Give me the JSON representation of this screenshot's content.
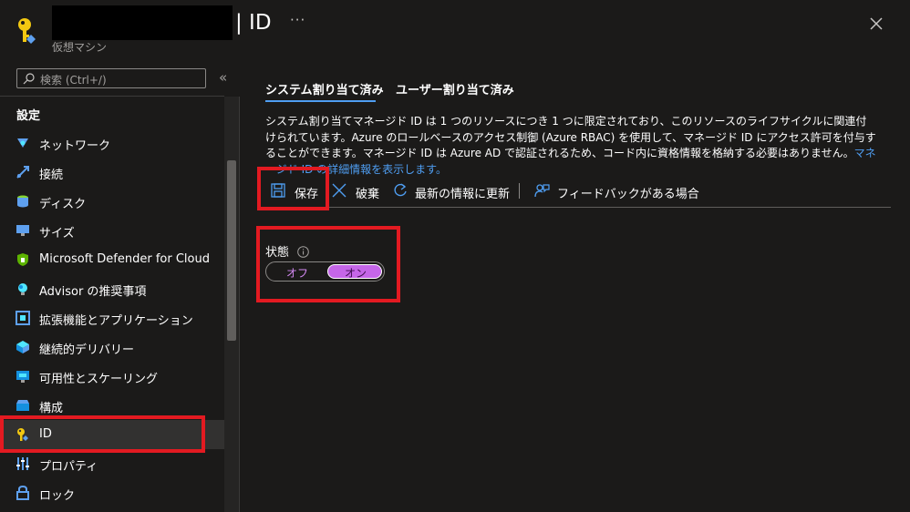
{
  "header": {
    "title": "| ID",
    "subtitle": "仮想マシン",
    "more": "···",
    "resource_icon": "key-icon",
    "close_icon": "close-icon"
  },
  "sidebar": {
    "search_placeholder": "検索 (Ctrl+/)",
    "collapse": "«",
    "section": "設定",
    "items": [
      {
        "label": "ネットワーク",
        "icon": "network-icon"
      },
      {
        "label": "接続",
        "icon": "connect-icon"
      },
      {
        "label": "ディスク",
        "icon": "disk-icon"
      },
      {
        "label": "サイズ",
        "icon": "monitor-icon"
      },
      {
        "label": "Microsoft Defender for Cloud",
        "icon": "shield-icon"
      },
      {
        "label": "Advisor の推奨事項",
        "icon": "advisor-icon"
      },
      {
        "label": "拡張機能とアプリケーション",
        "icon": "extensions-icon"
      },
      {
        "label": "継続的デリバリー",
        "icon": "delivery-icon"
      },
      {
        "label": "可用性とスケーリング",
        "icon": "scaling-icon"
      },
      {
        "label": "構成",
        "icon": "configuration-icon"
      },
      {
        "label": "ID",
        "icon": "key-icon",
        "selected": true
      },
      {
        "label": "プロパティ",
        "icon": "properties-icon"
      },
      {
        "label": "ロック",
        "icon": "lock-icon"
      }
    ]
  },
  "tabs": [
    {
      "label": "システム割り当て済み",
      "active": true
    },
    {
      "label": "ユーザー割り当て済み",
      "active": false
    }
  ],
  "description": {
    "text": "システム割り当てマネージド ID は 1 つのリソースにつき 1 つに限定されており、このリソースのライフサイクルに関連付けられています。Azure のロールベースのアクセス制御 (Azure RBAC) を使用して、マネージド ID にアクセス許可を付与することができます。マネージド ID は Azure AD で認証されるため、コード内に資格情報を格納する必要はありません。",
    "link": "マネージド ID の詳細情報を表示します。"
  },
  "toolbar": {
    "save": "保存",
    "discard": "破棄",
    "refresh": "最新の情報に更新",
    "feedback": "フィードバックがある場合"
  },
  "status": {
    "label": "状態",
    "off": "オフ",
    "on": "オン",
    "selected": "on"
  },
  "colors": {
    "background": "#1b1a19",
    "accent": "#4f9ef2",
    "toggle_on": "#c566e8",
    "highlight": "#e31a21"
  }
}
